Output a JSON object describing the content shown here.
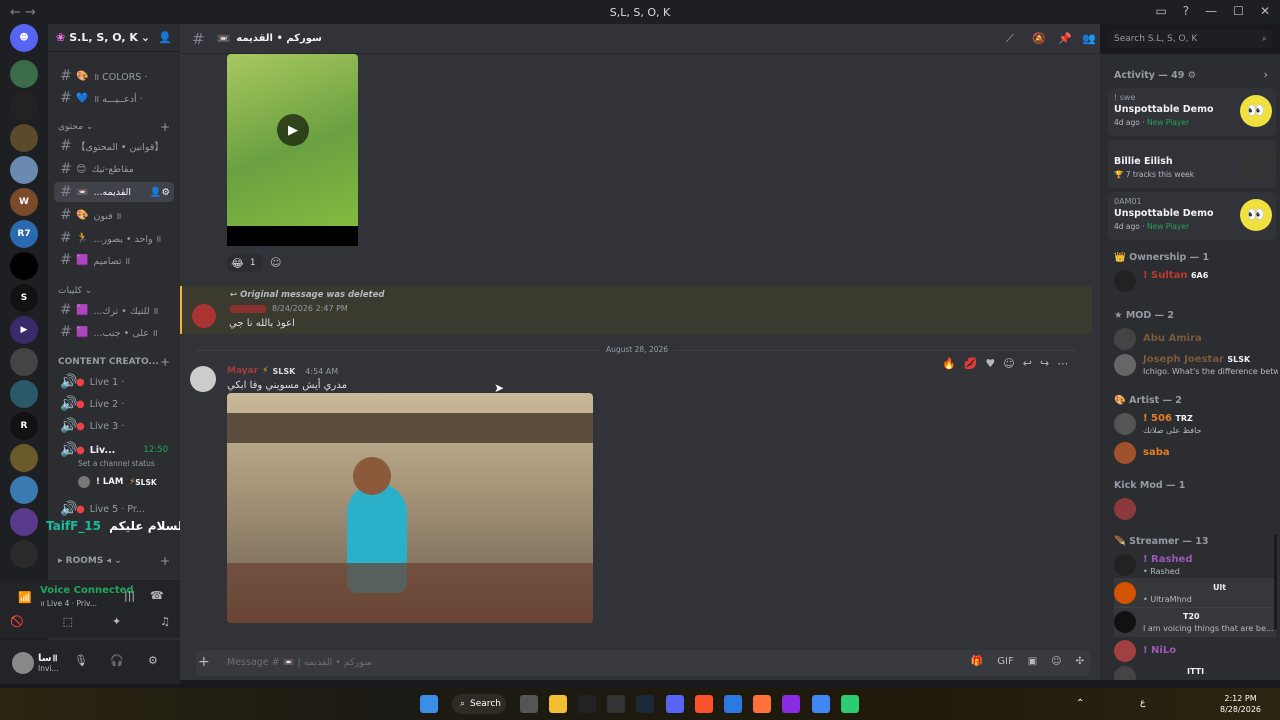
{
  "window": {
    "title": "S,L, S, O, K",
    "nav": "←  →"
  },
  "server": {
    "name": "S.L, S, O, K"
  },
  "channels": [
    {
      "emoji": "🎨",
      "label": "॥ COLORS ·"
    },
    {
      "emoji": "💙",
      "label": "॥ أدعــيـــه ·"
    },
    {
      "emoji": "",
      "label": "【قوانين • المحتوى】"
    },
    {
      "emoji": "😊",
      "label": "مقاطع-تيك"
    },
    {
      "emoji": "📼",
      "label": "...القديمه"
    },
    {
      "emoji": "🎨",
      "label": "فنون ॥"
    },
    {
      "emoji": "🏃",
      "label": "...واحد • يصور ॥"
    },
    {
      "emoji": "🟪",
      "label": "تصاميم ॥"
    },
    {
      "emoji": "🟪",
      "label": "...للتيك • ترك ॥"
    },
    {
      "emoji": "🟪",
      "label": "...على • جنب ॥"
    }
  ],
  "categories": {
    "content": "محتوى",
    "clips": "كليبات",
    "creators": "CONTENT CREATO...",
    "rooms": "ROOMS"
  },
  "voice_channels": [
    {
      "label": "Live 1 ·"
    },
    {
      "label": "Live 2 ·"
    },
    {
      "label": "Live 3 ·"
    },
    {
      "label": "Liv...",
      "time": "12:50"
    },
    {
      "label": "Live 5 · Pr..."
    }
  ],
  "voice_status": {
    "set_status": "Set a channel status",
    "user": "! LAM",
    "tag": "SLSK"
  },
  "overlay_name": "TaifF_15",
  "overlay_greeting": "السلام عليكم",
  "voice_panel": {
    "status": "Voice Connected",
    "channel": "॥ Live 4 · Priv..."
  },
  "userbar": {
    "name": "سا॥",
    "status": "Invi..."
  },
  "header": {
    "channel": "سوركم • القديمه"
  },
  "search": {
    "placeholder": "Search S.L, S, O, K"
  },
  "messages": {
    "reactions": {
      "count": "1"
    },
    "deleted_ref": "Original message was deleted",
    "reply_ts": "8/24/2026 2:47 PM",
    "reply_text": "اعوذ بالله نا جي",
    "date_divider": "August 28, 2026",
    "main_user": "Mayar",
    "main_tag": "SLSK",
    "main_ts": "4:54 AM",
    "main_text": "مدري أيش مسويني وفا ابكي"
  },
  "composer": {
    "placeholder": "Message # 📼 | سوركم • القديمه"
  },
  "activity": {
    "header": "Activity — 49",
    "items": [
      {
        "user": "! swe",
        "title": "Unspottable Demo",
        "meta": "4d ago",
        "badge": "New Player"
      },
      {
        "user": "",
        "title": "Billie Eilish",
        "meta": "7 tracks this week",
        "badge": ""
      },
      {
        "user": "0AM01",
        "title": "Unspottable Demo",
        "meta": "4d ago",
        "badge": "New Player"
      }
    ]
  },
  "member_groups": [
    {
      "title": "Ownership — 1"
    },
    {
      "title": "MOD — 2"
    },
    {
      "title": "Artist — 2"
    },
    {
      "title": "Kick Mod — 1"
    },
    {
      "title": "Streamer — 13"
    }
  ],
  "members": {
    "owner": {
      "name": "! Sultan",
      "tag": "6A6"
    },
    "mod1": {
      "name": "Abu Amira"
    },
    "mod2": {
      "name": "Joseph Joestar",
      "tag": "SLSK",
      "sub": "Ichigo. What's the difference betw..."
    },
    "artist1": {
      "name": "! 506",
      "tag": "TRZ",
      "sub": "حافظ على صلاتك"
    },
    "artist2": {
      "name": "saba"
    },
    "stream1": {
      "name": "! Rashed",
      "sub": "Rashed"
    },
    "stream2": {
      "name": "",
      "tag": "Ult",
      "sub": "UltraMhnd"
    },
    "stream3": {
      "name": "",
      "tag": "T20",
      "sub": "I am voicing things that are be..."
    },
    "stream4": {
      "name": "! NiLo"
    },
    "stream5": {
      "name": "",
      "tag": "ITTI",
      "sub": ""
    }
  },
  "taskbar": {
    "search": "Search",
    "time": "2:12 PM",
    "date": "8/28/2026",
    "lang": "ع"
  },
  "colors": {
    "accent": "#5865f2",
    "bg": "#313338",
    "sidebar": "#2b2d31"
  }
}
